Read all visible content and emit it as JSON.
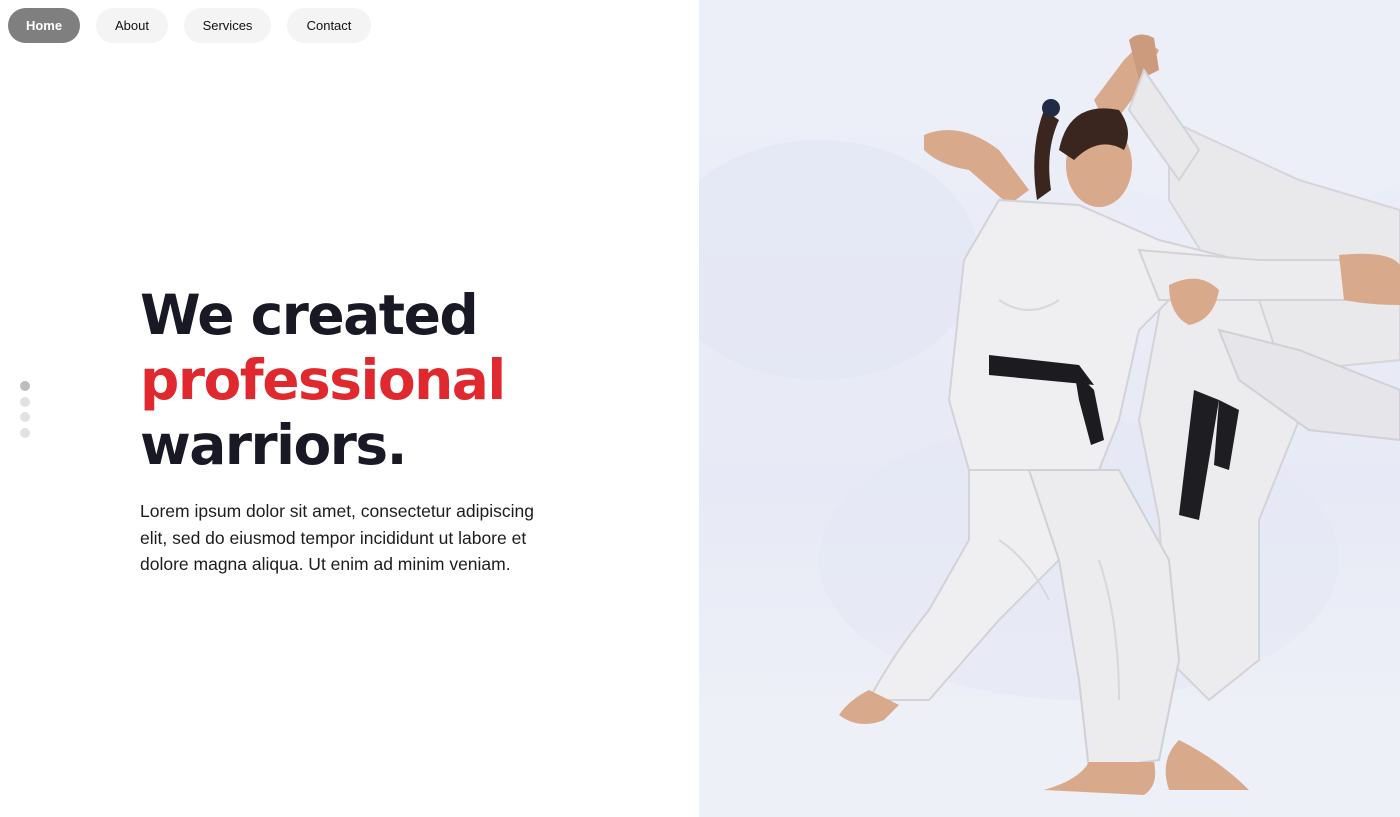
{
  "nav": {
    "items": [
      {
        "label": "Home",
        "active": true
      },
      {
        "label": "About",
        "active": false
      },
      {
        "label": "Services",
        "active": false
      },
      {
        "label": "Contact",
        "active": false
      }
    ]
  },
  "slider": {
    "dot_count": 4,
    "active_index": 0
  },
  "hero": {
    "headline_line1": "We created",
    "headline_line2": "professional",
    "headline_line3": "warriors.",
    "lead": "Lorem ipsum dolor sit amet, consectetur adipiscing elit, sed do eiusmod tempor incididunt ut labore et dolore magna aliqua. Ut enim ad minim veniam."
  },
  "colors": {
    "accent": "#e0292f",
    "headline": "#191825",
    "nav_active_bg": "#7f7f7f",
    "nav_bg": "#f4f4f4"
  },
  "image": {
    "subject": "karate-fighters-photo"
  }
}
